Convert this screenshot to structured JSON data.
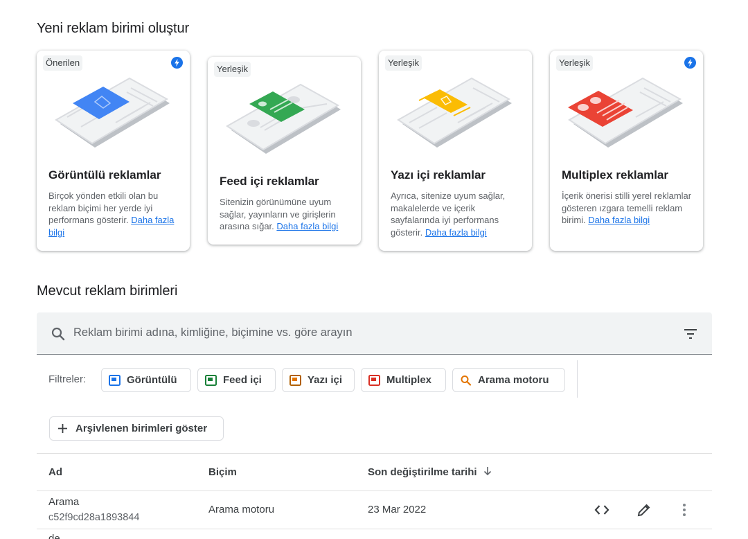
{
  "create_section": {
    "title": "Yeni reklam birimi oluştur"
  },
  "cards": [
    {
      "chip": "Önerilen",
      "title": "Görüntülü reklamlar",
      "desc": "Birçok yönden etkili olan bu reklam biçimi her yerde iyi performans gösterir. ",
      "link": "Daha fazla bilgi"
    },
    {
      "chip": "Yerleşik",
      "title": "Feed içi reklamlar",
      "desc": "Sitenizin görünümüne uyum sağlar, yayınların ve girişlerin arasına sığar. ",
      "link": "Daha fazla bilgi"
    },
    {
      "chip": "Yerleşik",
      "title": "Yazı içi reklamlar",
      "desc": "Ayrıca, sitenize uyum sağlar, makalelerde ve içerik sayfalarında iyi performans gösterir. ",
      "link": "Daha fazla bilgi"
    },
    {
      "chip": "Yerleşik",
      "title": "Multiplex reklamlar",
      "desc": "İçerik önerisi stilli yerel reklamlar gösteren ızgara temelli reklam birimi. ",
      "link": "Daha fazla bilgi"
    }
  ],
  "existing_section": {
    "title": "Mevcut reklam birimleri"
  },
  "search": {
    "placeholder": "Reklam birimi adına, kimliğine, biçimine vs. göre arayın"
  },
  "filters": {
    "label": "Filtreler:",
    "chips": [
      "Görüntülü",
      "Feed içi",
      "Yazı içi",
      "Multiplex",
      "Arama motoru"
    ]
  },
  "archive_button": {
    "label": "Arşivlenen birimleri göster"
  },
  "table": {
    "headers": {
      "name": "Ad",
      "format": "Biçim",
      "modified": "Son değiştirilme tarihi"
    },
    "rows": [
      {
        "name": "Arama",
        "id": "c52f9cd28a1893844",
        "format": "Arama motoru",
        "modified": "23 Mar 2022"
      },
      {
        "name": "de"
      }
    ]
  },
  "colors": {
    "display": "#4285f4",
    "feed": "#34a853",
    "inarticle": "#fbbc04",
    "multiplex": "#ea4335",
    "search": "#e37400",
    "link": "#1a73e8"
  }
}
